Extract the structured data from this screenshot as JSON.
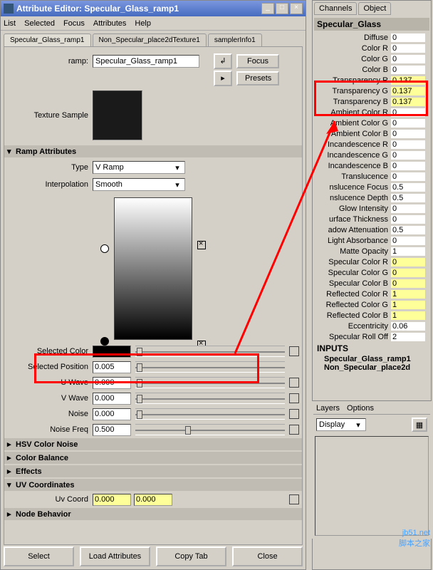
{
  "window": {
    "title": "Attribute Editor: Specular_Glass_ramp1"
  },
  "menu": [
    "List",
    "Selected",
    "Focus",
    "Attributes",
    "Help"
  ],
  "tabs": [
    "Specular_Glass_ramp1",
    "Non_Specular_place2dTexture1",
    "samplerInfo1"
  ],
  "ramp": {
    "label": "ramp:",
    "value": "Specular_Glass_ramp1",
    "focus": "Focus",
    "presets": "Presets"
  },
  "texture_label": "Texture Sample",
  "ramp_attrs_hdr": "Ramp Attributes",
  "type": {
    "label": "Type",
    "value": "V Ramp"
  },
  "interp": {
    "label": "Interpolation",
    "value": "Smooth"
  },
  "selcolor": {
    "label": "Selected Color"
  },
  "selpos": {
    "label": "Selected Position",
    "value": "0.005"
  },
  "uwave": {
    "label": "U Wave",
    "value": "0.000"
  },
  "vwave": {
    "label": "V Wave",
    "value": "0.000"
  },
  "noise": {
    "label": "Noise",
    "value": "0.000"
  },
  "noisefreq": {
    "label": "Noise Freq",
    "value": "0.500"
  },
  "sections": [
    "HSV Color Noise",
    "Color Balance",
    "Effects",
    "UV Coordinates",
    "Node Behavior"
  ],
  "uvcoord": {
    "label": "Uv Coord",
    "u": "0.000",
    "v": "0.000"
  },
  "bottom": [
    "Select",
    "Load Attributes",
    "Copy Tab",
    "Close"
  ],
  "channels": {
    "tabs": [
      "Channels",
      "Object"
    ],
    "header": "Specular_Glass",
    "rows": [
      {
        "l": "Diffuse",
        "v": "0",
        "y": false
      },
      {
        "l": "Color R",
        "v": "0",
        "y": false
      },
      {
        "l": "Color G",
        "v": "0",
        "y": false
      },
      {
        "l": "Color B",
        "v": "0",
        "y": false
      },
      {
        "l": "Transparency R",
        "v": "0.137",
        "y": true
      },
      {
        "l": "Transparency G",
        "v": "0.137",
        "y": true
      },
      {
        "l": "Transparency B",
        "v": "0.137",
        "y": true
      },
      {
        "l": "Ambient Color R",
        "v": "0",
        "y": false
      },
      {
        "l": "Ambient Color G",
        "v": "0",
        "y": false
      },
      {
        "l": "Ambient Color B",
        "v": "0",
        "y": false
      },
      {
        "l": "Incandescence R",
        "v": "0",
        "y": false
      },
      {
        "l": "Incandescence G",
        "v": "0",
        "y": false
      },
      {
        "l": "Incandescence B",
        "v": "0",
        "y": false
      },
      {
        "l": "Translucence",
        "v": "0",
        "y": false
      },
      {
        "l": "nslucence Focus",
        "v": "0.5",
        "y": false
      },
      {
        "l": "nslucence Depth",
        "v": "0.5",
        "y": false
      },
      {
        "l": "Glow Intensity",
        "v": "0",
        "y": false
      },
      {
        "l": "urface Thickness",
        "v": "0",
        "y": false
      },
      {
        "l": "adow Attenuation",
        "v": "0.5",
        "y": false
      },
      {
        "l": "Light Absorbance",
        "v": "0",
        "y": false
      },
      {
        "l": "Matte Opacity",
        "v": "1",
        "y": false
      },
      {
        "l": "Specular Color R",
        "v": "0",
        "y": true
      },
      {
        "l": "Specular Color G",
        "v": "0",
        "y": true
      },
      {
        "l": "Specular Color B",
        "v": "0",
        "y": true
      },
      {
        "l": "Reflected Color R",
        "v": "1",
        "y": true
      },
      {
        "l": "Reflected Color G",
        "v": "1",
        "y": true
      },
      {
        "l": "Reflected Color B",
        "v": "1",
        "y": true
      },
      {
        "l": "Eccentricity",
        "v": "0.06",
        "y": false
      },
      {
        "l": "Specular Roll Off",
        "v": "2",
        "y": false
      }
    ],
    "inputs_hdr": "INPUTS",
    "inputs": [
      "Specular_Glass_ramp1",
      "Non_Specular_place2d"
    ]
  },
  "layers": {
    "tabs": [
      "Layers",
      "Options"
    ],
    "display": "Display"
  },
  "watermark": {
    "url": "jb51.net",
    "cn": "脚本之家"
  }
}
